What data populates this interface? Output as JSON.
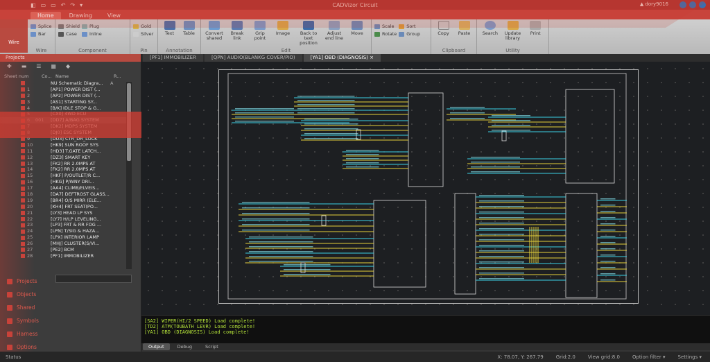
{
  "titlebar": {
    "title": "CADVizor Circuit",
    "quick_access": [
      "◧",
      "▭",
      "▭",
      "↶",
      "↷",
      "▾"
    ],
    "user": "▲ dory9016"
  },
  "ribbon_tabs": [
    "Home",
    "Drawing",
    "View"
  ],
  "ribbon": {
    "wire_label": "Wire",
    "groups": [
      {
        "label": "Wire",
        "small": [
          "Splice",
          "Bar"
        ],
        "big": []
      },
      {
        "label": "Component",
        "small": [
          "Shield",
          "Case",
          "Plug",
          "Inline"
        ],
        "big": []
      },
      {
        "label": "Pin",
        "small": [
          "Gold",
          "Silver"
        ],
        "big": []
      },
      {
        "label": "Annotation",
        "small": [],
        "big": [
          "Text",
          "Table"
        ]
      },
      {
        "label": "Edit",
        "small": [],
        "big": [
          "Convert shared",
          "Break link",
          "Grip point",
          "Image",
          "Back to text position",
          "Adjust end line",
          "Move"
        ]
      },
      {
        "label": "",
        "small": [
          "Scale",
          "Rotate",
          "Sort",
          "Group"
        ],
        "big": []
      },
      {
        "label": "Clipboard",
        "small": [],
        "big": [
          "Copy",
          "Paste"
        ]
      },
      {
        "label": "Utility",
        "small": [],
        "big": [
          "Search",
          "Update library",
          "Print"
        ]
      }
    ]
  },
  "left_panel": {
    "title": "Projects",
    "columns": [
      "Sheet num",
      "Co...",
      "Name",
      "R..."
    ],
    "rows": [
      {
        "num": "",
        "code": "",
        "name": "NU Schematic Diagra...",
        "cnt": "A"
      },
      {
        "num": "1",
        "code": "",
        "name": "[AP1] POWER DIST (...",
        "cnt": ""
      },
      {
        "num": "2",
        "code": "",
        "name": "[AP2] POWER DIST (...",
        "cnt": ""
      },
      {
        "num": "3",
        "code": "",
        "name": "[AS1] STARTING SY...",
        "cnt": ""
      },
      {
        "num": "4",
        "code": "",
        "name": "[B/K] IDLE STOP & G...",
        "cnt": ""
      },
      {
        "num": "5",
        "code": "",
        "name": "[CX0] 4WD ECU",
        "cnt": ""
      },
      {
        "num": "6",
        "code": "001",
        "name": "[DD7] A/BAG SYSTEM",
        "cnt": ""
      },
      {
        "num": "7",
        "code": "",
        "name": "[DK2] MDPS SYSTEM",
        "cnt": ""
      },
      {
        "num": "8",
        "code": "",
        "name": "[DJ0] ESC SYSTEM",
        "cnt": ""
      },
      {
        "num": "9",
        "code": "",
        "name": "[DU3] CTR_DR_LOCK",
        "cnt": ""
      },
      {
        "num": "10",
        "code": "",
        "name": "[HK9] SUN ROOF SYS",
        "cnt": ""
      },
      {
        "num": "11",
        "code": "",
        "name": "[HD3] T.GATE LATCH...",
        "cnt": ""
      },
      {
        "num": "12",
        "code": "",
        "name": "[DZ3] SMART KEY",
        "cnt": ""
      },
      {
        "num": "13",
        "code": "",
        "name": "[FK2] RR 2.0MPS AT",
        "cnt": ""
      },
      {
        "num": "14",
        "code": "",
        "name": "[FK2] RR 2.0MPS AT",
        "cnt": ""
      },
      {
        "num": "15",
        "code": "",
        "name": "[HKF] P/OUTLET/R C...",
        "cnt": ""
      },
      {
        "num": "16",
        "code": "",
        "name": "[HKG] P/WNY DRI...",
        "cnt": ""
      },
      {
        "num": "17",
        "code": "",
        "name": "[AA4] CLIMB/ELVEIS...",
        "cnt": ""
      },
      {
        "num": "18",
        "code": "",
        "name": "[DA7] DEFTROST GLASS...",
        "cnt": ""
      },
      {
        "num": "19",
        "code": "",
        "name": "[BR4] O/S MIRR (ELE...",
        "cnt": ""
      },
      {
        "num": "20",
        "code": "",
        "name": "[KH4] FRT SEAT(PO...",
        "cnt": ""
      },
      {
        "num": "21",
        "code": "",
        "name": "[LY3] HEAD LP SYS",
        "cnt": ""
      },
      {
        "num": "22",
        "code": "",
        "name": "[LY7] H/LP LEVELING...",
        "cnt": ""
      },
      {
        "num": "23",
        "code": "",
        "name": "[LP3] FRT & RR FOG ...",
        "cnt": ""
      },
      {
        "num": "24",
        "code": "",
        "name": "[LPN] T/SIG & HAZA...",
        "cnt": ""
      },
      {
        "num": "25",
        "code": "",
        "name": "[LPX] INTERIOR LAMP",
        "cnt": ""
      },
      {
        "num": "26",
        "code": "",
        "name": "[MHJ] CLUSTER(S/VI...",
        "cnt": ""
      },
      {
        "num": "27",
        "code": "",
        "name": "[PE2] BCM",
        "cnt": ""
      },
      {
        "num": "28",
        "code": "",
        "name": "[PF1] IMMOBILIZER",
        "cnt": ""
      }
    ],
    "nav": [
      "Projects",
      "Objects",
      "Shared",
      "Symbols",
      "Harness",
      "Options"
    ]
  },
  "doc_tabs": [
    "[PF1] IMMOBILIZER",
    "[QPN] AUDIO(BLANKG COVER/PIO)",
    "[YA1] OBD (DIAGNOSIS) ×"
  ],
  "console": {
    "lines": [
      "[SA2] WIPER(HI/2 SPEED) Load complete!",
      "[TD2] ATM(TOUBATH LEVR) Load complete!",
      "[YA1] OBD (DIAGNOSIS) Load complete!"
    ],
    "tabs": [
      "Output",
      "Debug",
      "Script"
    ]
  },
  "status": {
    "left": "Status",
    "coords": "X: 78.07, Y: 267.79",
    "grid": "Grid:2.0",
    "view_grid": "View grid:8.0",
    "option_filter": "Option filter ▾",
    "settings": "Settings ▾"
  },
  "colors": {
    "accent": "#c8443c",
    "wire_yellow": "#e6d23a",
    "wire_cyan": "#3ad0e6",
    "console_green": "#b6e43a"
  }
}
